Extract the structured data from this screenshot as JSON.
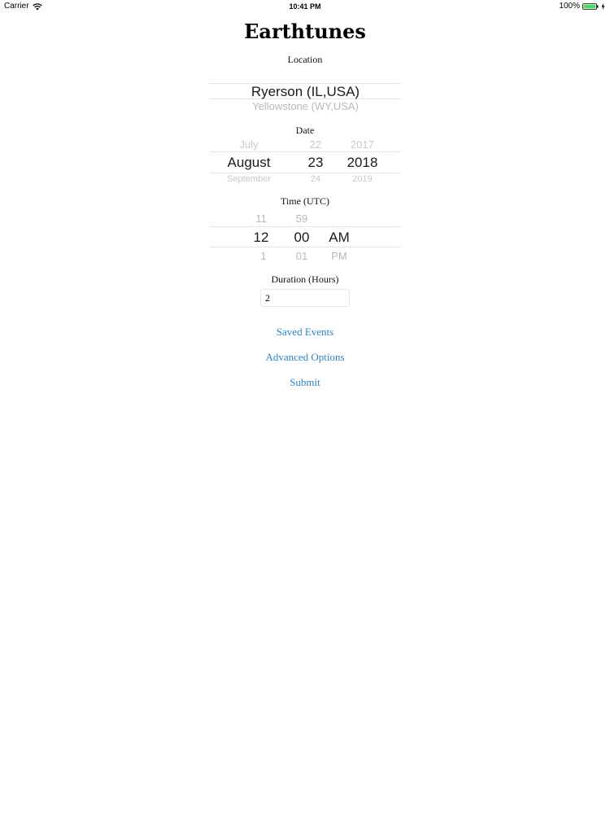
{
  "status_bar": {
    "carrier": "Carrier",
    "time": "10:41 PM",
    "battery": "100%"
  },
  "app": {
    "title": "Earthtunes"
  },
  "location": {
    "label": "Location",
    "selected": "Ryerson (IL,USA)",
    "next": "Yellowstone (WY,USA)"
  },
  "date": {
    "label": "Date",
    "month": {
      "prev": "July",
      "selected": "August",
      "next": "September"
    },
    "day": {
      "prev": "22",
      "selected": "23",
      "next": "24"
    },
    "year": {
      "prev": "2017",
      "selected": "2018",
      "next": "2019"
    }
  },
  "time": {
    "label": "Time (UTC)",
    "hour": {
      "prev": "11",
      "selected": "12",
      "next": "1"
    },
    "minute": {
      "prev": "59",
      "selected": "00",
      "next": "01"
    },
    "ampm": {
      "selected": "AM",
      "next": "PM"
    }
  },
  "duration": {
    "label": "Duration (Hours)",
    "value": "2"
  },
  "actions": {
    "saved_events": "Saved Events",
    "advanced_options": "Advanced Options",
    "submit": "Submit"
  },
  "colors": {
    "link": "#2b83c6",
    "battery": "#4cd964"
  }
}
